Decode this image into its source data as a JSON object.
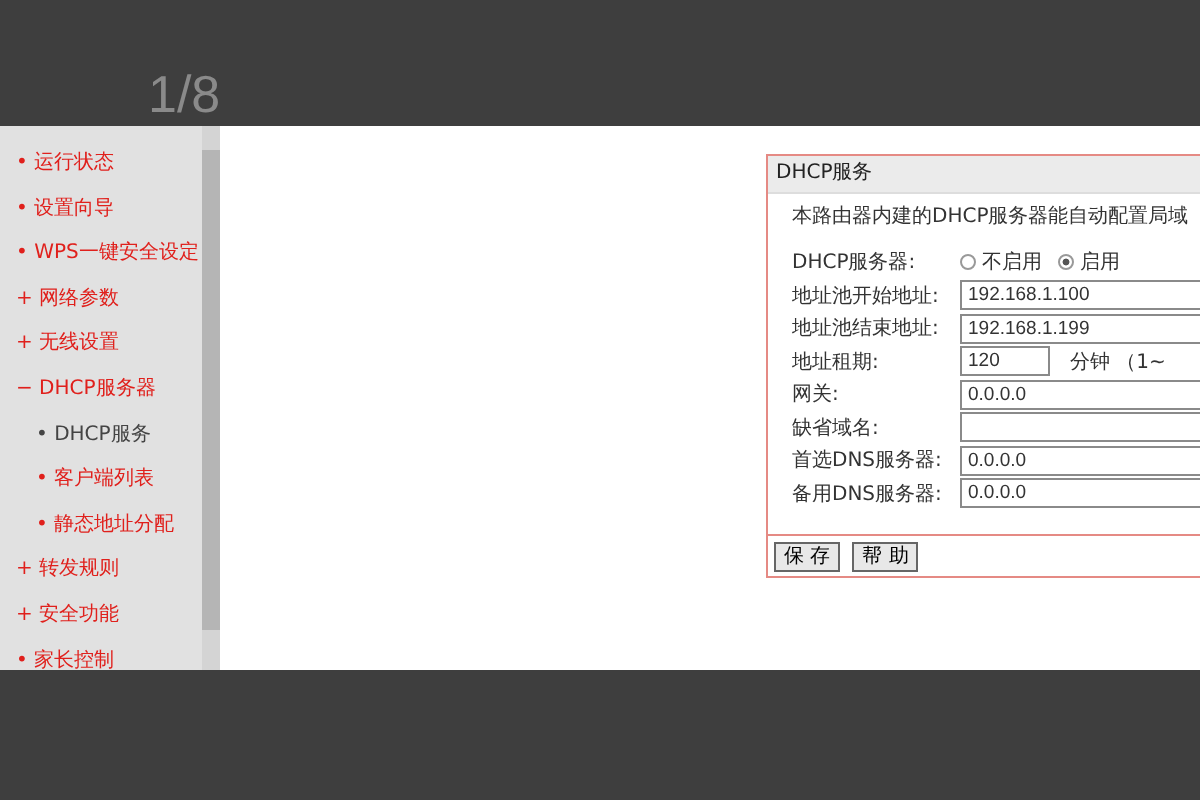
{
  "page_counter": "1/8",
  "sidebar": {
    "items": [
      {
        "marker": "•",
        "label": "运行状态",
        "selected": false
      },
      {
        "marker": "•",
        "label": "设置向导",
        "selected": false
      },
      {
        "marker": "•",
        "label": "WPS一键安全设定",
        "selected": false
      },
      {
        "marker": "+",
        "label": "网络参数",
        "selected": false
      },
      {
        "marker": "+",
        "label": "无线设置",
        "selected": false
      },
      {
        "marker": "−",
        "label": "DHCP服务器",
        "selected": false,
        "children": [
          {
            "marker": "•",
            "label": "DHCP服务",
            "selected": true
          },
          {
            "marker": "•",
            "label": "客户端列表",
            "selected": false
          },
          {
            "marker": "•",
            "label": "静态地址分配",
            "selected": false
          }
        ]
      },
      {
        "marker": "+",
        "label": "转发规则",
        "selected": false
      },
      {
        "marker": "+",
        "label": "安全功能",
        "selected": false
      },
      {
        "marker": "•",
        "label": "家长控制",
        "selected": false
      }
    ]
  },
  "panel": {
    "title": "DHCP服务",
    "description": "本路由器内建的DHCP服务器能自动配置局域",
    "fields": [
      {
        "kind": "radio",
        "label": "DHCP服务器:",
        "options": [
          {
            "label": "不启用",
            "selected": false
          },
          {
            "label": "启用",
            "selected": true
          }
        ]
      },
      {
        "kind": "text",
        "label": "地址池开始地址:",
        "value": "192.168.1.100"
      },
      {
        "kind": "text",
        "label": "地址池结束地址:",
        "value": "192.168.1.199"
      },
      {
        "kind": "short",
        "label": "地址租期:",
        "value": "120",
        "unit": "分钟 （1~"
      },
      {
        "kind": "text",
        "label": "网关:",
        "value": "0.0.0.0"
      },
      {
        "kind": "text",
        "label": "缺省域名:"
      },
      {
        "kind": "text",
        "label": "首选DNS服务器:",
        "value": "0.0.0.0"
      },
      {
        "kind": "text",
        "label": "备用DNS服务器:",
        "value": "0.0.0.0"
      }
    ],
    "buttons": [
      "保 存",
      "帮 助"
    ]
  }
}
